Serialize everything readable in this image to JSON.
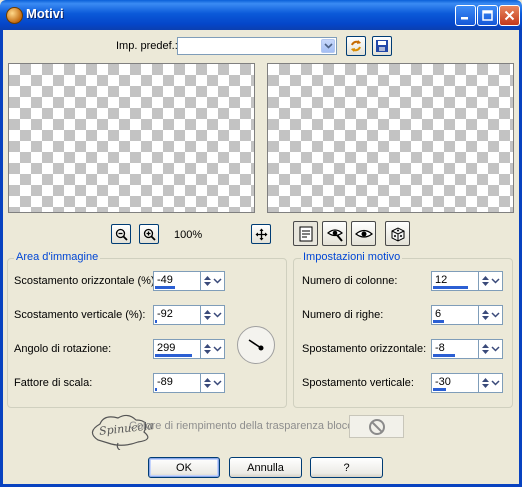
{
  "window": {
    "title": "Motivi"
  },
  "preset": {
    "label": "Imp. predef.:",
    "value": ""
  },
  "zoom": {
    "level": "100%"
  },
  "area": {
    "title": "Area d'immagine",
    "fields": [
      {
        "label": "Scostamento orizzontale (%):",
        "value": "-49",
        "level": 0.45
      },
      {
        "label": "Scostamento verticale (%):",
        "value": "-92",
        "level": 0.05
      },
      {
        "label": "Angolo di rotazione:",
        "value": "299",
        "level": 0.85
      },
      {
        "label": "Fattore di scala:",
        "value": "-89",
        "level": 0.05
      }
    ]
  },
  "settings": {
    "title": "Impostazioni motivo",
    "fields": [
      {
        "label": "Numero di colonne:",
        "value": "12",
        "level": 0.8
      },
      {
        "label": "Numero di righe:",
        "value": "6",
        "level": 0.25
      },
      {
        "label": "Spostamento orizzontale:",
        "value": "-8",
        "level": 0.5
      },
      {
        "label": "Spostamento verticale:",
        "value": "-30",
        "level": 0.3
      }
    ]
  },
  "fill": {
    "label": "Colore di riempimento della trasparenza bloccato:"
  },
  "watermark": {
    "text": "Spinuccia"
  },
  "buttons": {
    "ok": "OK",
    "cancel": "Annulla",
    "help": "?"
  },
  "colors": {
    "accent": "#0046d5",
    "titlebar": "#0a5fd8"
  }
}
